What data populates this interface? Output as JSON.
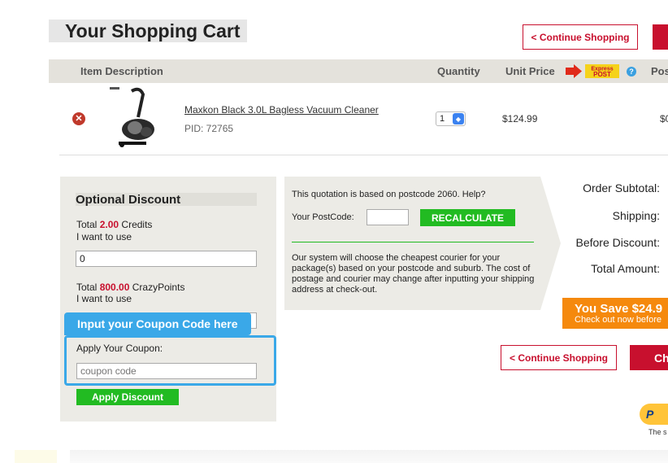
{
  "header": {
    "title": "Your Shopping Cart",
    "continue_label": "< Continue Shopping"
  },
  "columns": {
    "item_description": "Item Description",
    "quantity": "Quantity",
    "unit_price": "Unit Price",
    "express_post_top": "Express",
    "express_post_bottom": "POST",
    "postage": "Pos"
  },
  "item": {
    "remove_glyph": "✕",
    "name": "Maxkon Black 3.0L Bagless Vacuum Cleaner",
    "pid": "PID: 72765",
    "quantity": "1",
    "unit_price": "$124.99",
    "row_total": "$0"
  },
  "discount": {
    "title": "Optional Discount",
    "credits_prefix": "Total",
    "credits_value": "2.00",
    "credits_suffix": "Credits",
    "credits_use": "I want to use",
    "credits_input": "0",
    "points_prefix": "Total",
    "points_value": "800.00",
    "points_suffix": "CrazyPoints",
    "points_use": "I want to use",
    "tooltip": "Input your Coupon Code here",
    "coupon_label": "Apply Your Coupon:",
    "coupon_placeholder": "coupon code",
    "apply_label": "Apply Discount"
  },
  "quotation": {
    "basis": "This quotation is based on postcode 2060. Help?",
    "postcode_label": "Your PostCode:",
    "recalculate": "RECALCULATE",
    "courier_note": "Our system will choose the cheapest courier for your package(s) based on your postcode and suburb. The cost of postage and courier may change after inputting your shipping address at check-out."
  },
  "totals": {
    "subtotal": "Order Subtotal:",
    "shipping": "Shipping:",
    "before_discount": "Before Discount:",
    "total_amount": "Total Amount:"
  },
  "savings": {
    "headline": "You Save $24.9",
    "sub": "Check out now before"
  },
  "footer": {
    "continue_label": "< Continue Shopping",
    "checkout_label": "Ch",
    "paypal_glyph": "P",
    "paypal_sub": "The s"
  }
}
